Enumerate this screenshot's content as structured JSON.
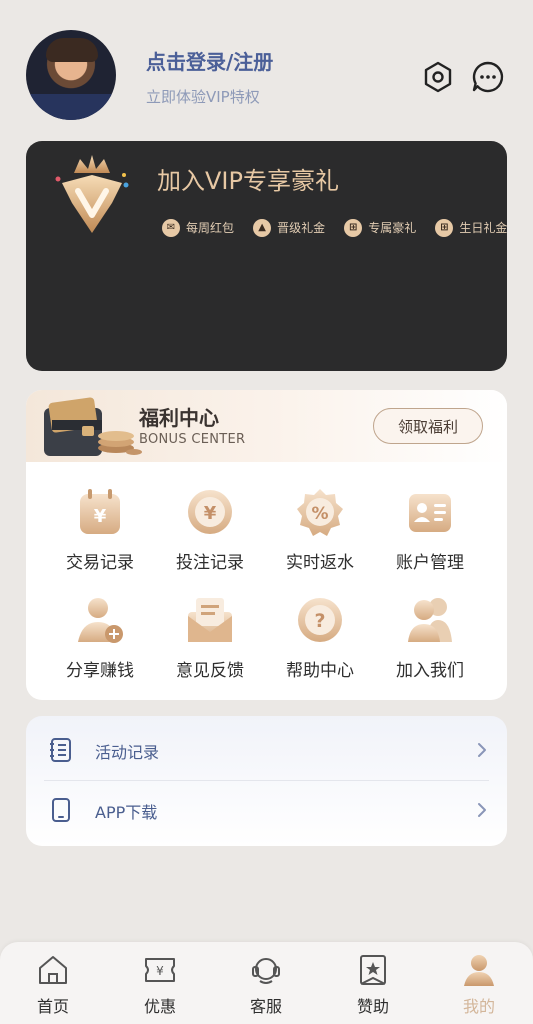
{
  "header": {
    "login_title": "点击登录/注册",
    "login_subtitle": "立即体验VIP特权",
    "icons": [
      "settings-icon",
      "chat-icon"
    ]
  },
  "vip": {
    "title": "加入VIP专享豪礼",
    "perks": [
      {
        "icon": "red-packet-icon",
        "label": "每周红包"
      },
      {
        "icon": "level-up-icon",
        "label": "晋级礼金"
      },
      {
        "icon": "gift-icon",
        "label": "专属豪礼"
      },
      {
        "icon": "birthday-gift-icon",
        "label": "生日礼金"
      }
    ]
  },
  "bonus": {
    "title": "福利中心",
    "subtitle": "BONUS CENTER",
    "claim_button": "领取福利",
    "grid": [
      {
        "icon": "transaction-record-icon",
        "label": "交易记录"
      },
      {
        "icon": "bet-record-icon",
        "label": "投注记录"
      },
      {
        "icon": "rebate-icon",
        "label": "实时返水"
      },
      {
        "icon": "account-icon",
        "label": "账户管理"
      },
      {
        "icon": "share-user-icon",
        "label": "分享赚钱"
      },
      {
        "icon": "feedback-envelope-icon",
        "label": "意见反馈"
      },
      {
        "icon": "help-icon",
        "label": "帮助中心"
      },
      {
        "icon": "join-us-icon",
        "label": "加入我们"
      }
    ]
  },
  "list": [
    {
      "icon": "activity-list-icon",
      "label": "活动记录"
    },
    {
      "icon": "phone-icon",
      "label": "APP下载"
    }
  ],
  "nav": [
    {
      "icon": "home-icon",
      "label": "首页"
    },
    {
      "icon": "coupon-icon",
      "label": "优惠"
    },
    {
      "icon": "support-headset-icon",
      "label": "客服"
    },
    {
      "icon": "sponsor-icon",
      "label": "赞助"
    },
    {
      "icon": "profile-icon",
      "label": "我的",
      "active": true
    }
  ],
  "colors": {
    "accent_blue": "#4b5f98",
    "gold": "#e7c8a4",
    "vip_card_bg": "#2b2b2c",
    "page_bg": "#ebe8e5"
  }
}
